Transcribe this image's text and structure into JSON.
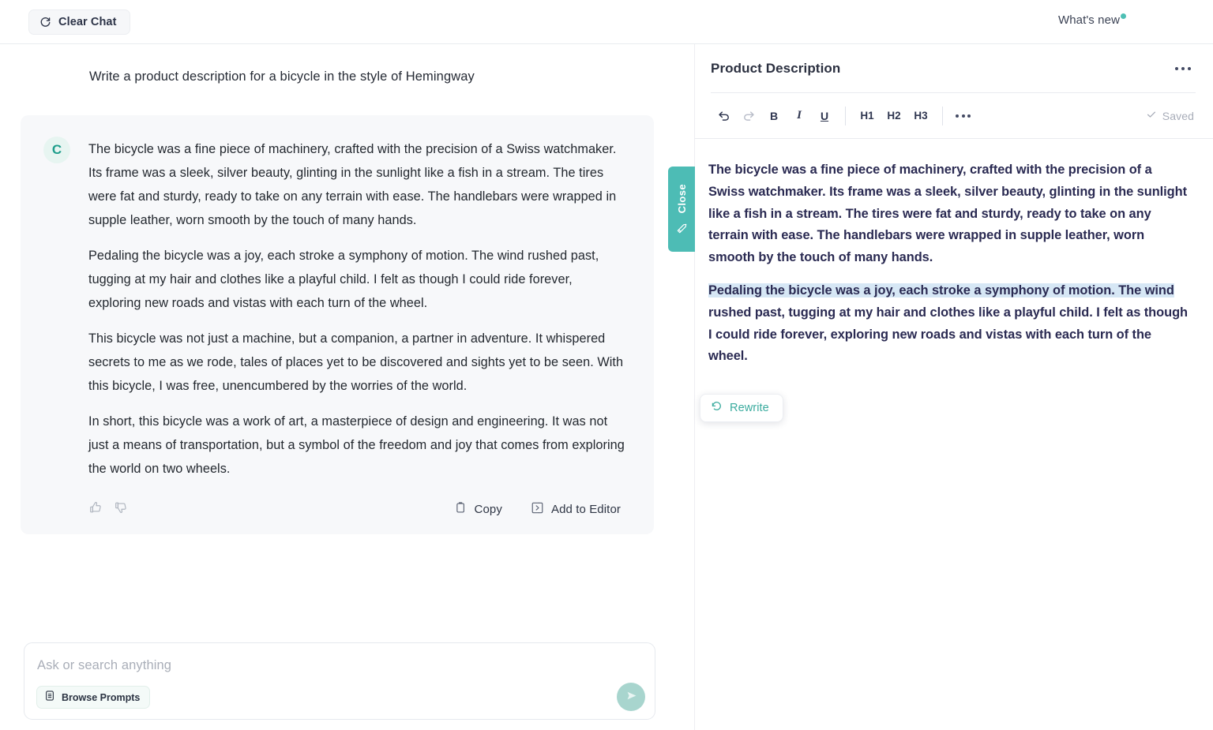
{
  "topbar": {
    "clear_chat_label": "Clear Chat",
    "clear_chat_icon": "refresh-icon",
    "whats_new_label": "What's new",
    "whats_new_badge_color": "#4dbfb4"
  },
  "chat": {
    "user_prompt": "Write a product description for a bicycle in the style of Hemingway",
    "avatar_letter": "C",
    "avatar_color": "#1f9e8c",
    "answer_paragraphs": [
      "The bicycle was a fine piece of machinery, crafted with the precision of a Swiss watchmaker. Its frame was a sleek, silver beauty, glinting in the sunlight like a fish in a stream. The tires were fat and sturdy, ready to take on any terrain with ease. The handlebars were wrapped in supple leather, worn smooth by the touch of many hands.",
      "Pedaling the bicycle was a joy, each stroke a symphony of motion. The wind rushed past, tugging at my hair and clothes like a playful child. I felt as though I could ride forever, exploring new roads and vistas with each turn of the wheel.",
      "This bicycle was not just a machine, but a companion, a partner in adventure. It whispered secrets to me as we rode, tales of places yet to be discovered and sights yet to be seen. With this bicycle, I was free, unencumbered by the worries of the world.",
      "In short, this bicycle was a work of art, a masterpiece of design and engineering. It was not just a means of transportation, but a symbol of the freedom and joy that comes from exploring the world on two wheels."
    ],
    "actions": {
      "thumbs_up_icon": "thumbs-up-icon",
      "thumbs_down_icon": "thumbs-down-icon",
      "copy_label": "Copy",
      "copy_icon": "clipboard-icon",
      "add_to_editor_label": "Add to Editor",
      "add_to_editor_icon": "add-to-editor-icon"
    }
  },
  "composer": {
    "placeholder": "Ask or search anything",
    "value": "",
    "browse_prompts_label": "Browse Prompts",
    "browse_prompts_icon": "prompt-list-icon",
    "send_icon": "send-arrow-icon",
    "send_button_color": "#a8d5ce"
  },
  "close_tab": {
    "label": "Close",
    "icon": "pencil-icon",
    "color": "#4dbcb5"
  },
  "editor": {
    "title": "Product Description",
    "more_icon": "more-horizontal-icon",
    "toolbar": {
      "undo_icon": "undo-icon",
      "redo_icon": "redo-icon",
      "bold_label": "B",
      "italic_label": "I",
      "underline_label": "U",
      "h1_label": "H1",
      "h2_label": "H2",
      "h3_label": "H3",
      "more_icon": "more-horizontal-icon",
      "saved_label": "Saved",
      "saved_icon": "check-icon"
    },
    "paragraph_1": "The bicycle was a fine piece of machinery, crafted with the precision of a Swiss watchmaker. Its frame was a sleek, silver beauty, glinting in the sunlight like a fish in a stream. The tires were fat and sturdy, ready to take on any terrain with ease. The handlebars were wrapped in supple leather, worn smooth by the touch of many hands.",
    "paragraph_2_selected": "Pedaling the bicycle was a joy, each stroke a symphony of motion. The wind",
    "paragraph_2_rest": " rushed past, tugging at my hair and clothes like a playful child. I felt as though I could ride forever, exploring new roads and vistas with each turn of the wheel.",
    "selection_color": "#d6e7f5",
    "text_color": "#2a2a52"
  },
  "rewrite_popup": {
    "label": "Rewrite",
    "icon": "rewrite-refresh-icon",
    "color": "#3aab9e"
  }
}
